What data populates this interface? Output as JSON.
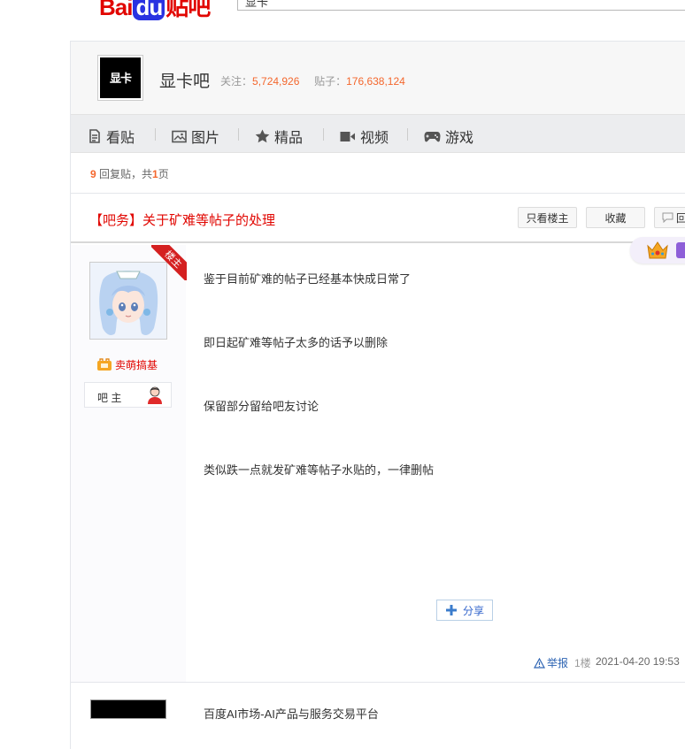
{
  "header": {
    "logo_text": "Bai",
    "logo_du": "du",
    "logo_tieba": "贴吧",
    "search_value": "显卡"
  },
  "forum": {
    "name": "显卡吧",
    "avatar_text": "显卡",
    "follow_label": "关注：",
    "follow_count": "5,724,926",
    "posts_label": "贴子：",
    "posts_count": "176,638,124"
  },
  "nav": [
    {
      "label": "看贴",
      "icon": "document-icon"
    },
    {
      "label": "图片",
      "icon": "picture-icon"
    },
    {
      "label": "精品",
      "icon": "star-icon"
    },
    {
      "label": "视频",
      "icon": "video-camera-icon"
    },
    {
      "label": "游戏",
      "icon": "gamepad-icon"
    }
  ],
  "thread": {
    "reply_num": "9",
    "reply_text": "回复贴，共",
    "page_num": "1",
    "page_text": "页",
    "title": "【吧务】关于矿难等帖子的处理",
    "btn_only_op": "只看楼主",
    "btn_collect": "收藏",
    "btn_reply": "回"
  },
  "post": {
    "badge": "楼主",
    "username": "卖萌搞基",
    "role": "吧 主",
    "paragraphs": [
      "鉴于目前矿难的帖子已经基本快成日常了",
      "即日起矿难等帖子太多的话予以删除",
      "保留部分留给吧友讨论",
      "类似跌一点就发矿难等帖子水贴的，一律删帖"
    ],
    "share_label": "分享",
    "report_label": "举报",
    "floor": "1楼",
    "time": "2021-04-20 19:53"
  },
  "next_post": {
    "preview": "百度AI市场-AI产品与服务交易平台"
  },
  "colors": {
    "accent_red": "#e10601",
    "count_orange": "#f4672d",
    "link_blue": "#2d64b3"
  }
}
